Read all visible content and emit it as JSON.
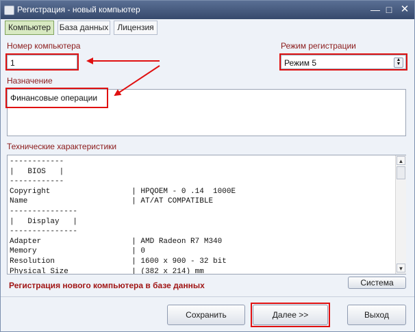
{
  "window": {
    "title": "Регистрация - новый компьютер",
    "controls": {
      "minimize": "—",
      "maximize": "□",
      "close": "✕"
    }
  },
  "tabs": [
    {
      "label": "Компьютер",
      "active": true
    },
    {
      "label": "База данных",
      "active": false
    },
    {
      "label": "Лицензия",
      "active": false
    }
  ],
  "computer_number": {
    "label": "Номер компьютера",
    "value": "1"
  },
  "registration_mode": {
    "label": "Режим регистрации",
    "value": "Режим 5"
  },
  "purpose": {
    "label": "Назначение",
    "value": "Финансовые операции"
  },
  "specs": {
    "label": "Технические характеристики",
    "text": "------------\n|   BIOS   |\n------------\nCopyright                  | HPQOEM - 0 .14  1000E\nName                       | AT/AT COMPATIBLE\n---------------\n|   Display   |\n---------------\nAdapter                    | AMD Radeon R7 M340\nMemory                     | 0\nResolution                 | 1600 x 900 - 32 bit\nPhysical Size              | (382 x 214) mm"
  },
  "system_button": "Система",
  "status_message": "Регистрация нового компьютера в базе данных",
  "buttons": {
    "save": "Сохранить",
    "next": "Далее >>",
    "exit": "Выход"
  },
  "colors": {
    "label_text": "#8b1a1a",
    "highlight": "#e01010",
    "active_tab": "#d8e9c2",
    "titlebar": "#3d5074"
  }
}
